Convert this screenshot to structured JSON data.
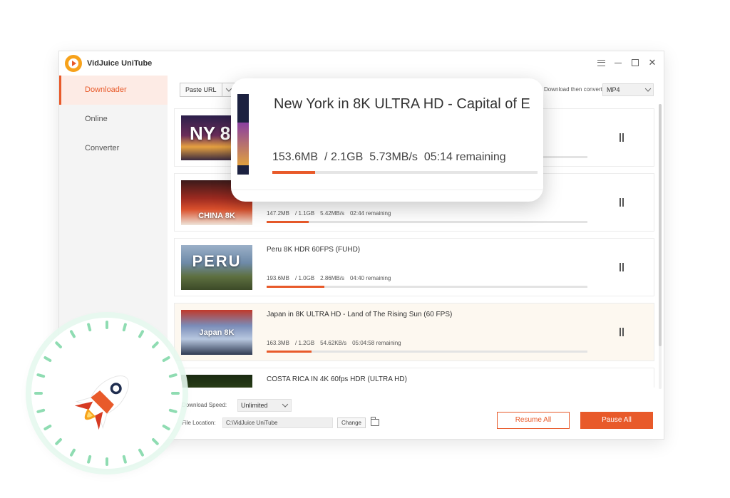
{
  "app": {
    "title": "VidJuice UniTube"
  },
  "sidebar": {
    "items": [
      {
        "label": "Downloader",
        "active": true
      },
      {
        "label": "Online",
        "active": false
      },
      {
        "label": "Converter",
        "active": false
      }
    ]
  },
  "toolbar": {
    "paste_label": "Paste URL",
    "convert_label": "Download then convert to:",
    "convert_value": "MP4"
  },
  "downloads": [
    {
      "title": "",
      "downloaded": "",
      "total": "",
      "speed": "",
      "remaining": "",
      "progress": 0.07,
      "thumb_text": "NY 8K"
    },
    {
      "title": "",
      "downloaded": "147.2MB",
      "total": "1.1GB",
      "speed": "5.42MB/s",
      "remaining": "02:44 remaining",
      "progress": 0.13,
      "thumb_text": "CHINA 8K"
    },
    {
      "title": "Peru 8K HDR 60FPS (FUHD)",
      "downloaded": "193.6MB",
      "total": "1.0GB",
      "speed": "2.86MB/s",
      "remaining": "04:40 remaining",
      "progress": 0.18,
      "thumb_text": "PERU"
    },
    {
      "title": "Japan in 8K ULTRA HD - Land of The Rising Sun (60 FPS)",
      "downloaded": "163.3MB",
      "total": "1.2GB",
      "speed": "54.62KB/s",
      "remaining": "05:04:58 remaining",
      "progress": 0.14,
      "thumb_text": "Japan 8K"
    },
    {
      "title": "COSTA RICA IN 4K 60fps HDR (ULTRA HD)",
      "downloaded": "",
      "total": "",
      "speed": "",
      "remaining": "",
      "progress": 0,
      "thumb_text": ""
    }
  ],
  "popup": {
    "title": "New York in 8K ULTRA HD - Capital of E",
    "downloaded": "153.6MB",
    "total": "2.1GB",
    "speed": "5.73MB/s",
    "remaining": "05:14 remaining",
    "progress": 0.16
  },
  "footer": {
    "speed_label": "Download Speed:",
    "speed_value": "Unlimited",
    "location_label": "File Location:",
    "location_value": "C:\\VidJuice UniTube",
    "change_label": "Change",
    "resume_all_label": "Resume All",
    "pause_all_label": "Pause All"
  },
  "colors": {
    "accent": "#e85a2a",
    "badge_tick": "#8fdcb2"
  },
  "icons": [
    "menu-icon",
    "minimize-icon",
    "maximize-icon",
    "close-icon",
    "pause-icon",
    "folder-icon",
    "rocket-icon"
  ]
}
